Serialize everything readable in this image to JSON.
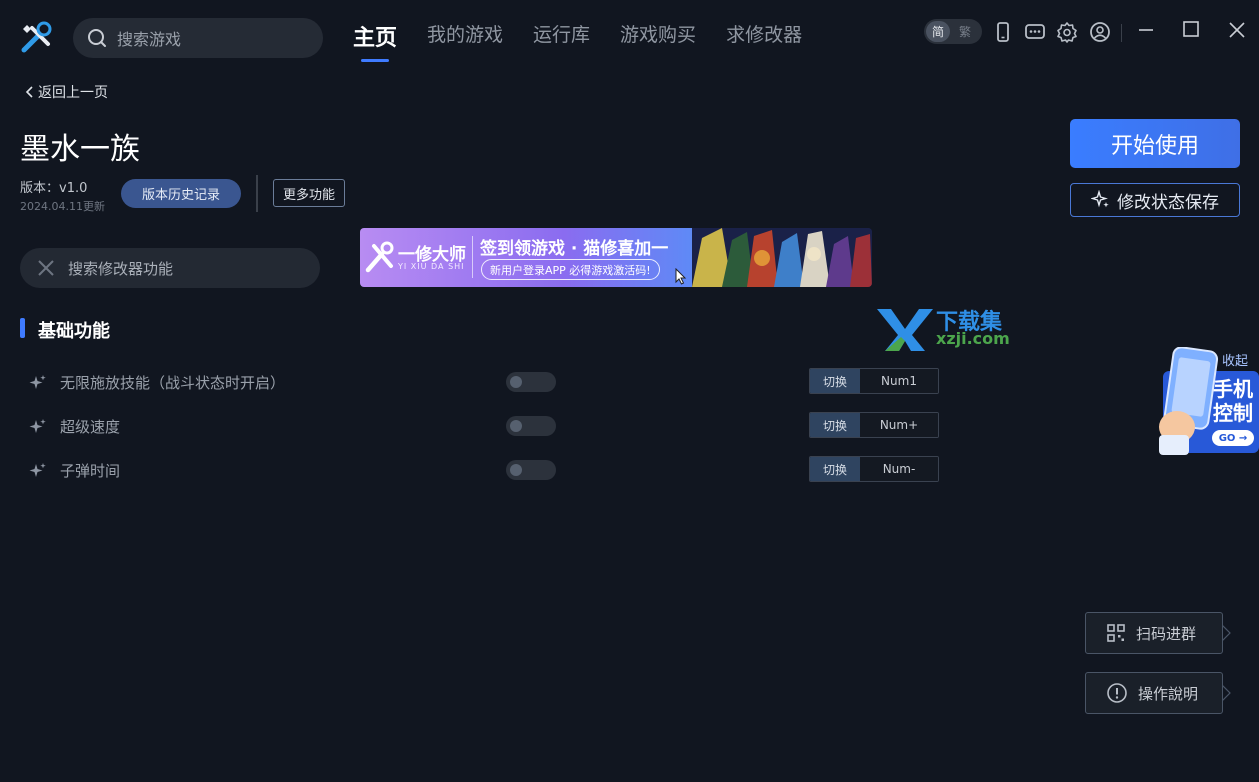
{
  "header": {
    "search_placeholder": "搜索游戏",
    "nav": [
      {
        "label": "主页",
        "active": true
      },
      {
        "label": "我的游戏",
        "active": false
      },
      {
        "label": "运行库",
        "active": false
      },
      {
        "label": "游戏购买",
        "active": false
      },
      {
        "label": "求修改器",
        "active": false
      }
    ],
    "lang_simplified": "简",
    "lang_traditional": "繁",
    "icons": [
      "phone-icon",
      "message-icon",
      "gear-icon",
      "user-icon",
      "minimize-icon",
      "maximize-icon",
      "close-icon"
    ]
  },
  "back_label": "返回上一页",
  "game": {
    "title": "墨水一族",
    "version": "版本：v1.0",
    "updated": "2024.04.11更新",
    "history_label": "版本历史记录",
    "more_label": "更多功能"
  },
  "actions": {
    "start_label": "开始使用",
    "save_label": "修改状态保存"
  },
  "banner": {
    "brand": "一修大师",
    "brand_sub": "YI XIU DA SHI",
    "title": "签到领游戏 · 猫修喜加一",
    "subtitle": "新用户登录APP  必得游戏激活码!"
  },
  "watermark": {
    "line1": "下载集",
    "line2": "xzji.com"
  },
  "feature_search_placeholder": "搜索修改器功能",
  "section_title": "基础功能",
  "features": [
    {
      "label": "无限施放技能（战斗状态时开启）",
      "enabled": false,
      "mode": "切换",
      "key": "Num1"
    },
    {
      "label": "超级速度",
      "enabled": false,
      "mode": "切换",
      "key": "Num+"
    },
    {
      "label": "子弹时间",
      "enabled": false,
      "mode": "切换",
      "key": "Num-"
    }
  ],
  "phone_promo": {
    "collapse_label": "收起",
    "title_line1": "手机",
    "title_line2": "控制",
    "go_label": "GO →"
  },
  "float_buttons": {
    "qr_label": "扫码进群",
    "help_label": "操作說明"
  },
  "colors": {
    "background": "#111620",
    "accent": "#3f7bff",
    "start_button": "#3a7dff"
  }
}
